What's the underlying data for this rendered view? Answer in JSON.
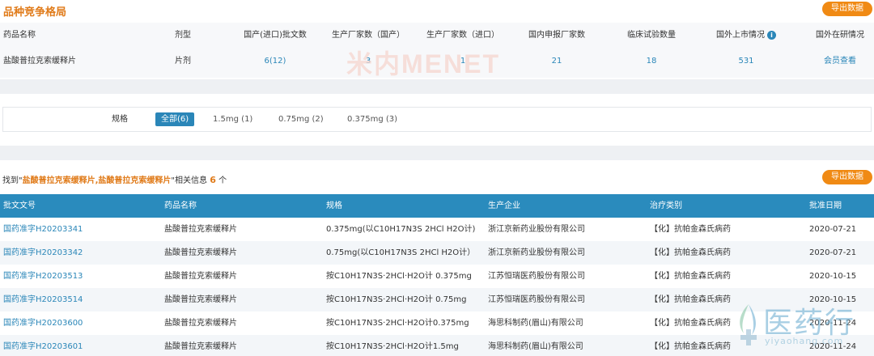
{
  "section_title": "品种竞争格局",
  "export_label": "导出数据",
  "competition": {
    "headers": [
      "药品名称",
      "剂型",
      "国产(进口)批文数",
      "生产厂家数（国产）",
      "生产厂家数（进口）",
      "国内申报厂家数",
      "临床试验数量",
      "国外上市情况",
      "国外在研情况"
    ],
    "row": [
      "盐酸普拉克索缓释片",
      "片剂",
      "6(12)",
      "3",
      "1",
      "21",
      "18",
      "531",
      "会员查看"
    ]
  },
  "watermark": "米内MENET",
  "spec": {
    "label": "规格",
    "options": [
      "全部(6)",
      "1.5mg (1)",
      "0.75mg (2)",
      "0.375mg (3)"
    ]
  },
  "found": {
    "prefix": "找到\"",
    "keyword": "盐酸普拉克索缓释片,盐酸普拉克索缓释片",
    "middle": "\"相关信息",
    "count": "6",
    "suffix": "个"
  },
  "grid": {
    "headers": [
      "批文文号",
      "药品名称",
      "规格",
      "生产企业",
      "治疗类别",
      "批准日期"
    ],
    "rows": [
      [
        "国药准字H20203341",
        "盐酸普拉克索缓释片",
        "0.375mg(以C10H17N3S 2HCl H2O计)",
        "浙江京新药业股份有限公司",
        "【化】抗帕金森氏病药",
        "2020-07-21"
      ],
      [
        "国药准字H20203342",
        "盐酸普拉克索缓释片",
        "0.75mg(以C10H17N3S 2HCl H2O计）",
        "浙江京新药业股份有限公司",
        "【化】抗帕金森氏病药",
        "2020-07-21"
      ],
      [
        "国药准字H20203513",
        "盐酸普拉克索缓释片",
        "按C10H17N3S·2HCl·H2O计 0.375mg",
        "江苏恒瑞医药股份有限公司",
        "【化】抗帕金森氏病药",
        "2020-10-15"
      ],
      [
        "国药准字H20203514",
        "盐酸普拉克索缓释片",
        "按C10H17N3S·2HCl·H2O计 0.75mg",
        "江苏恒瑞医药股份有限公司",
        "【化】抗帕金森氏病药",
        "2020-10-15"
      ],
      [
        "国药准字H20203600",
        "盐酸普拉克索缓释片",
        "按C10H17N3S·2HCl·H2O计0.375mg",
        "海思科制药(眉山)有限公司",
        "【化】抗帕金森氏病药",
        "2020-11-24"
      ],
      [
        "国药准字H20203601",
        "盐酸普拉克索缓释片",
        "按C10H17N3S·2HCl·H2O计1.5mg",
        "海思科制药(眉山)有限公司",
        "【化】抗帕金森氏病药",
        "2020-11-24"
      ]
    ]
  },
  "corner_logo": {
    "name": "医药行",
    "url": "yiyaohang.com"
  },
  "colors": {
    "accent_orange": "#f08a14",
    "header_blue": "#2a8bbd",
    "link_blue": "#2a86b8"
  }
}
